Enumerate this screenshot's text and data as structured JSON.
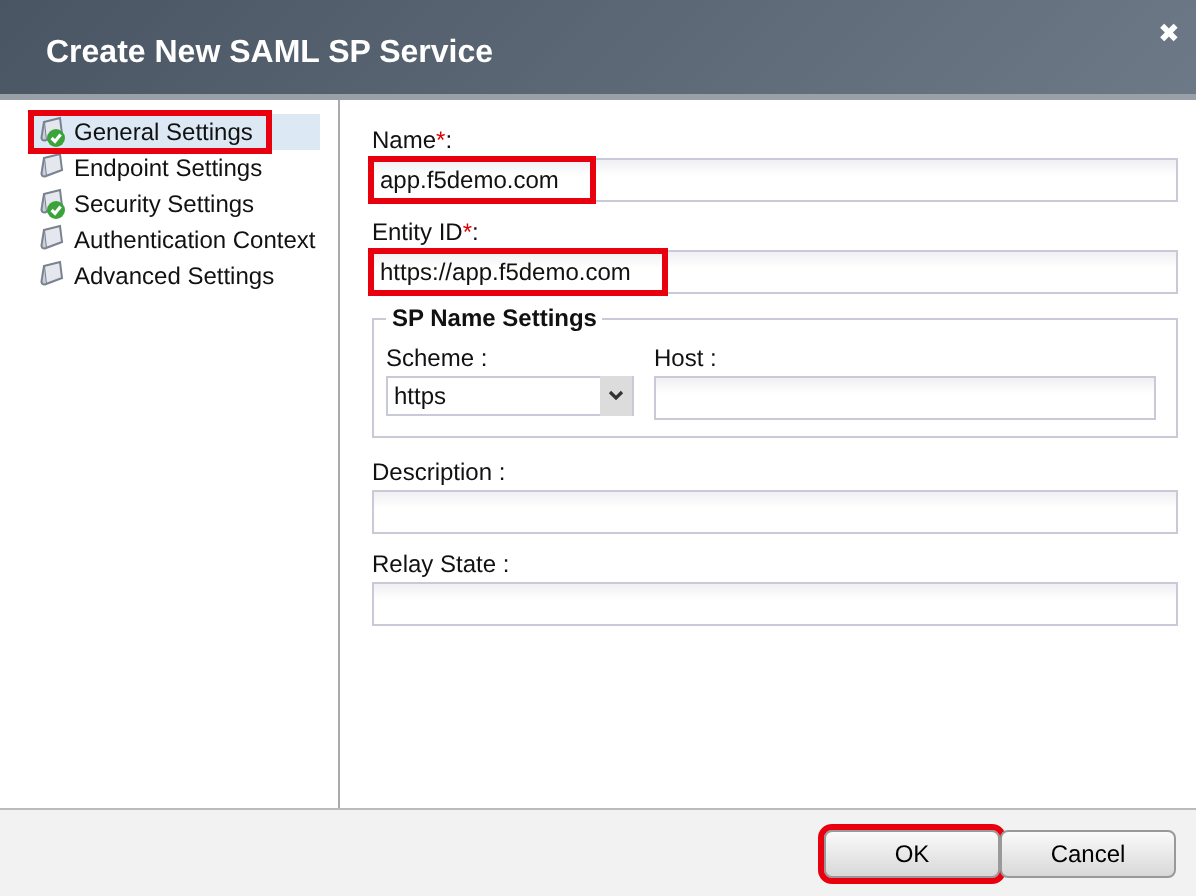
{
  "window": {
    "title": "Create New SAML SP Service",
    "close": "✖"
  },
  "sidebar": {
    "items": [
      {
        "label": "General Settings",
        "selected": true,
        "complete": true,
        "highlighted": true
      },
      {
        "label": "Endpoint Settings",
        "selected": false,
        "complete": false,
        "highlighted": false
      },
      {
        "label": "Security Settings",
        "selected": false,
        "complete": true,
        "highlighted": false
      },
      {
        "label": "Authentication Context",
        "selected": false,
        "complete": false,
        "highlighted": false
      },
      {
        "label": "Advanced Settings",
        "selected": false,
        "complete": false,
        "highlighted": false
      }
    ]
  },
  "fields_top": [
    {
      "label": "Name",
      "mark": "*",
      "suffix": ":",
      "value": "app.f5demo.com",
      "highlighted": true
    },
    {
      "label": "Entity ID",
      "mark": "*",
      "suffix": ":",
      "value": "https://app.f5demo.com",
      "highlighted": true
    }
  ],
  "sp_name_settings": {
    "legend": "SP Name Settings",
    "scheme": {
      "label": "Scheme :",
      "value": "https"
    },
    "host": {
      "label": "Host :"
    }
  },
  "fields_bottom": [
    {
      "label": "Description :"
    },
    {
      "label": "Relay State :"
    }
  ],
  "buttons": [
    {
      "label": "OK",
      "highlighted": true
    },
    {
      "label": "Cancel",
      "highlighted": false
    }
  ]
}
